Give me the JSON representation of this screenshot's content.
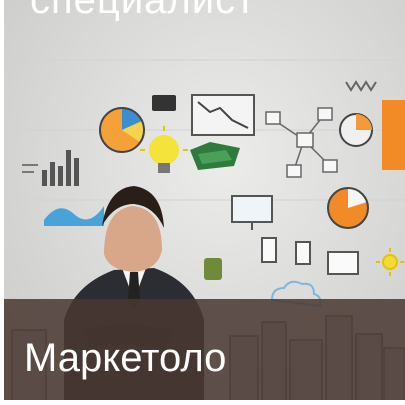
{
  "card": {
    "top_title": "специалист",
    "caption": "Маркетоло"
  }
}
